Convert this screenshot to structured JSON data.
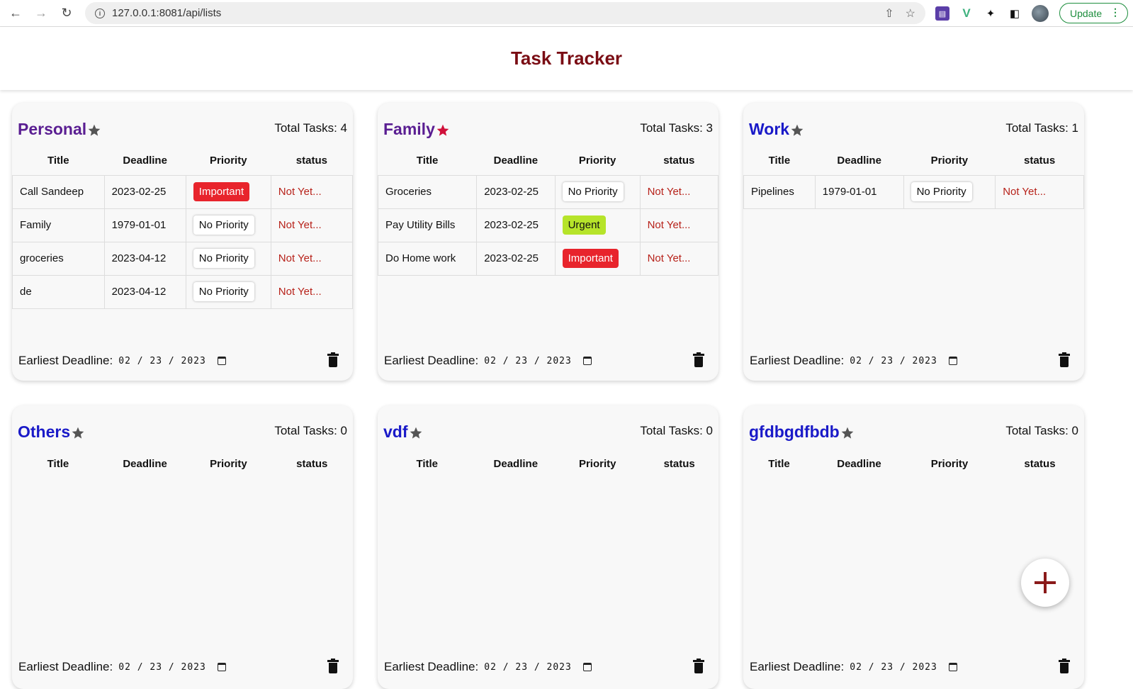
{
  "browser": {
    "url": "127.0.0.1:8081/api/lists",
    "update_label": "Update"
  },
  "app": {
    "title": "Task Tracker"
  },
  "colors": {
    "title": "#7a0d14",
    "important": "#e8242c",
    "urgent": "#b6e42a",
    "status": "#b7221a",
    "star_grey": "#555555",
    "star_red": "#d0103a"
  },
  "columns": [
    "Title",
    "Deadline",
    "Priority",
    "status"
  ],
  "footer_label": "Earliest Deadline:",
  "lists": [
    {
      "name": "Personal",
      "name_color": "#5a1e92",
      "star_color": "#555555",
      "total_label": "Total Tasks: 4",
      "earliest": "02/23/2023",
      "tasks": [
        {
          "title": "Call Sandeep",
          "deadline": "2023-02-25",
          "priority": "Important",
          "priority_type": "important",
          "status": "Not Yet..."
        },
        {
          "title": "Family",
          "deadline": "1979-01-01",
          "priority": "No Priority",
          "priority_type": "none",
          "status": "Not Yet..."
        },
        {
          "title": "groceries",
          "deadline": "2023-04-12",
          "priority": "No Priority",
          "priority_type": "none",
          "status": "Not Yet..."
        },
        {
          "title": "de",
          "deadline": "2023-04-12",
          "priority": "No Priority",
          "priority_type": "none",
          "status": "Not Yet..."
        }
      ]
    },
    {
      "name": "Family",
      "name_color": "#5a1e92",
      "star_color": "#d0103a",
      "total_label": "Total Tasks: 3",
      "earliest": "02/23/2023",
      "tasks": [
        {
          "title": "Groceries",
          "deadline": "2023-02-25",
          "priority": "No Priority",
          "priority_type": "none",
          "status": "Not Yet..."
        },
        {
          "title": "Pay Utility Bills",
          "deadline": "2023-02-25",
          "priority": "Urgent",
          "priority_type": "urgent",
          "status": "Not Yet..."
        },
        {
          "title": "Do Home work",
          "deadline": "2023-02-25",
          "priority": "Important",
          "priority_type": "important",
          "status": "Not Yet..."
        }
      ]
    },
    {
      "name": "Work",
      "name_color": "#1a1ac8",
      "star_color": "#555555",
      "total_label": "Total Tasks: 1",
      "earliest": "02/23/2023",
      "tasks": [
        {
          "title": "Pipelines",
          "deadline": "1979-01-01",
          "priority": "No Priority",
          "priority_type": "none",
          "status": "Not Yet..."
        }
      ]
    },
    {
      "name": "Others",
      "name_color": "#1a1ac8",
      "star_color": "#555555",
      "total_label": "Total Tasks: 0",
      "earliest": "02/23/2023",
      "tasks": []
    },
    {
      "name": "vdf",
      "name_color": "#1a1ac8",
      "star_color": "#555555",
      "total_label": "Total Tasks: 0",
      "earliest": "02/23/2023",
      "tasks": []
    },
    {
      "name": "gfdbgdfbdb",
      "name_color": "#1a1ac8",
      "star_color": "#555555",
      "total_label": "Total Tasks: 0",
      "earliest": "02/23/2023",
      "tasks": []
    }
  ]
}
